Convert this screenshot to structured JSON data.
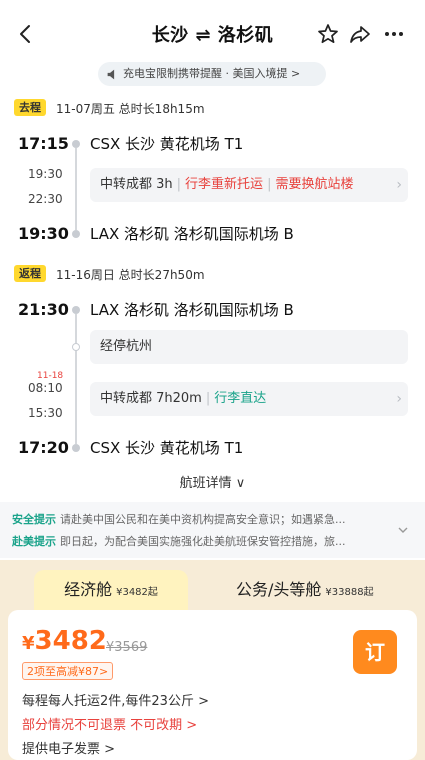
{
  "header": {
    "title": "长沙 ⇌ 洛杉矶",
    "notice": "充电宝限制携带提醒 · 美国入境提 >"
  },
  "outbound": {
    "tag": "去程",
    "meta": "11-07周五  总时长18h15m",
    "depart_time": "17:15",
    "depart_airport": "CSX  长沙  黄花机场  T1",
    "transfer_arrive": "19:30",
    "transfer_depart": "22:30",
    "transfer_text": "中转成都 3h",
    "transfer_warn1": "行李重新托运",
    "transfer_warn2": "需要换航站楼",
    "arrive_time": "19:30",
    "arrive_airport": "LAX  洛杉矶  洛杉矶国际机场  B"
  },
  "inbound": {
    "tag": "返程",
    "meta": "11-16周日  总时长27h50m",
    "depart_time": "21:30",
    "depart_airport": "LAX  洛杉矶  洛杉矶国际机场  B",
    "stop_text": "经停杭州",
    "transfer_date": "11-18",
    "transfer_arrive": "08:10",
    "transfer_depart": "15:30",
    "transfer_text": "中转成都 7h20m",
    "transfer_ok": "行李直达",
    "arrive_time": "17:20",
    "arrive_airport": "CSX  长沙  黄花机场  T1"
  },
  "details_label": "航班详情 ∨",
  "tips": {
    "safety_key": "安全提示",
    "safety_text": "请赴美中国公民和在美中资机构提高安全意识；如遇紧急...",
    "us_key": "赴美提示",
    "us_text": "即日起，为配合美国实施强化赴美航班保安管控措施，旅..."
  },
  "cabins": {
    "economy_name": "经济舱",
    "economy_price": "¥3482起",
    "business_name": "公务/头等舱",
    "business_price": "¥33888起"
  },
  "offer": {
    "currency": "¥",
    "price": "3482",
    "old_price": "¥3569",
    "drop_label": "2项至高减¥87>",
    "book_label": "订",
    "baggage": "每程每人托运2件,每件23公斤 >",
    "refund": "部分情况不可退票  不可改期 >",
    "invoice": "提供电子发票 >"
  },
  "colors": {
    "accent": "#ff6a1a",
    "tag_yellow": "#ffd82e",
    "warn_red": "#e8423d",
    "ok_green": "#1aa38a"
  }
}
